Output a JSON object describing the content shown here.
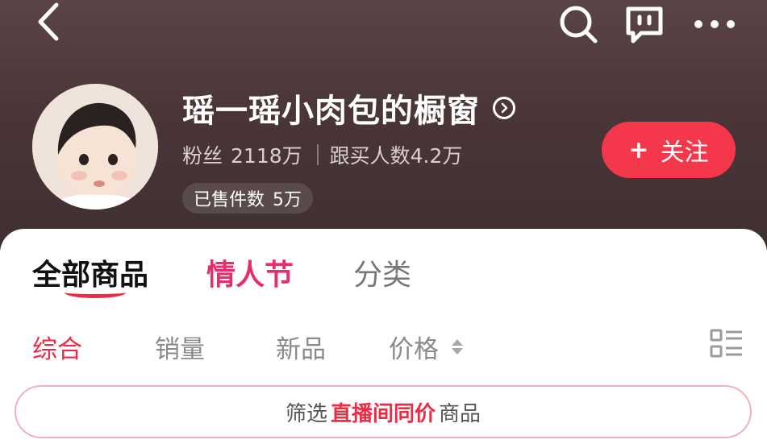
{
  "header": {
    "icons": {
      "back": "chevron-left-icon",
      "search": "search-icon",
      "chat": "chat-icon",
      "more": "more-icon"
    }
  },
  "store": {
    "name": "瑶一瑶小肉包的橱窗",
    "fans_label": "粉丝",
    "fans_count": "2118万",
    "followers_buy_label": "跟买人数",
    "followers_buy_count": "4.2万",
    "sold_label": "已售件数",
    "sold_count": "5万"
  },
  "follow_button": {
    "plus": "+",
    "label": "关注"
  },
  "tabs": [
    {
      "label": "全部商品",
      "active": true
    },
    {
      "label": "情人节",
      "active": false
    },
    {
      "label": "分类",
      "active": false
    }
  ],
  "sort": [
    {
      "label": "综合",
      "active": true
    },
    {
      "label": "销量",
      "active": false
    },
    {
      "label": "新品",
      "active": false
    },
    {
      "label": "价格",
      "active": false
    }
  ],
  "filter": {
    "prefix": "筛选",
    "highlight": "直播间同价",
    "suffix": "商品"
  },
  "colors": {
    "accent": "#ee2b45",
    "follow": "#f5374c",
    "valentine": "#e92c6d"
  }
}
